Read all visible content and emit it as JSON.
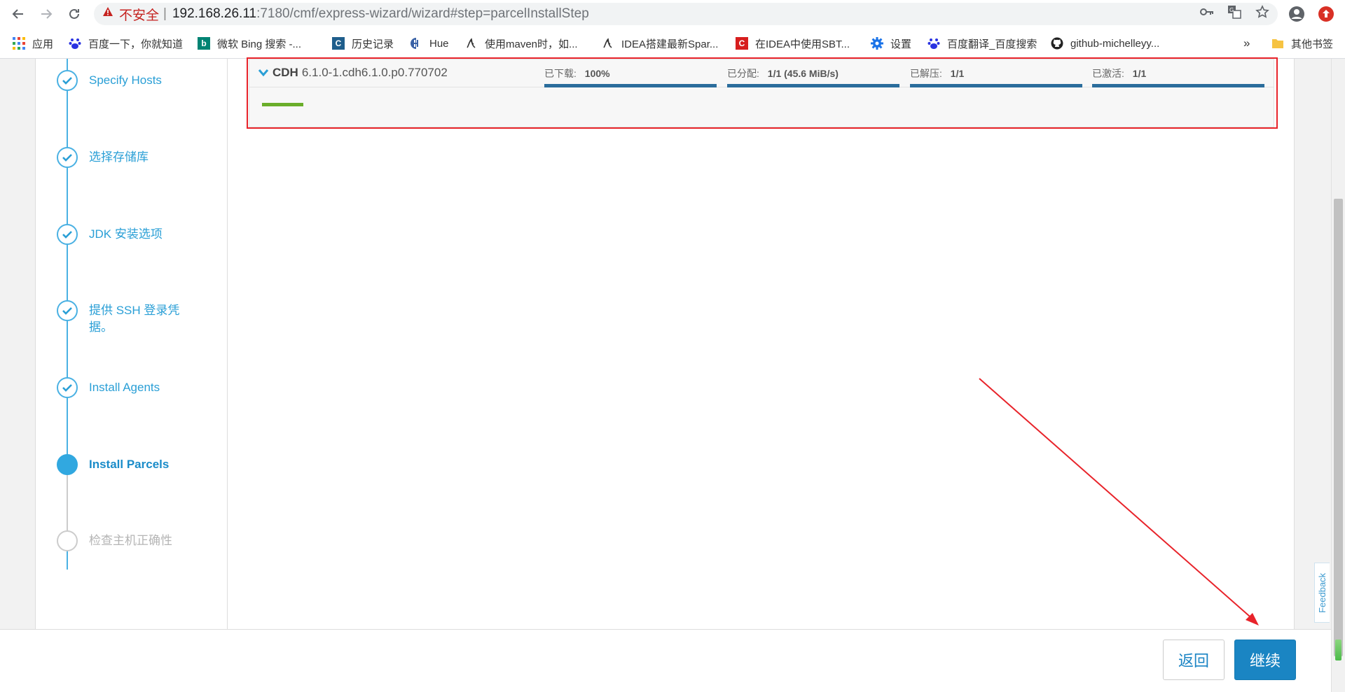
{
  "browser": {
    "security_warning": "不安全",
    "separator": "|",
    "url_host": "192.168.26.11",
    "url_path": ":7180/cmf/express-wizard/wizard#step=parcelInstallStep",
    "bookmarks": [
      {
        "label": "应用",
        "icon": "apps-grid-icon"
      },
      {
        "label": "百度一下，你就知道",
        "icon": "baidu-paw-icon"
      },
      {
        "label": "微软 Bing 搜索 -...",
        "icon": "bing-icon"
      },
      {
        "label": "历史记录",
        "icon": "history-c-icon"
      },
      {
        "label": "Hue",
        "icon": "hue-icon"
      },
      {
        "label": "使用maven时，如...",
        "icon": "script-icon"
      },
      {
        "label": "IDEA搭建最新Spar...",
        "icon": "script-icon"
      },
      {
        "label": "在IDEA中使用SBT...",
        "icon": "csdn-icon"
      },
      {
        "label": "设置",
        "icon": "gear-icon"
      },
      {
        "label": "百度翻译_百度搜索",
        "icon": "baidu-paw-icon"
      },
      {
        "label": "github-michelleyy...",
        "icon": "github-icon"
      }
    ],
    "overflow": "»",
    "other_bookmarks": "其他书签"
  },
  "wizard": {
    "steps": [
      {
        "label": "Specify Hosts",
        "state": "done"
      },
      {
        "label": "选择存储库",
        "state": "done"
      },
      {
        "label": "JDK 安装选项",
        "state": "done"
      },
      {
        "label": "提供 SSH 登录凭据。",
        "state": "done"
      },
      {
        "label": "Install Agents",
        "state": "done"
      },
      {
        "label": "Install Parcels",
        "state": "active"
      },
      {
        "label": "检查主机正确性",
        "state": "pending"
      }
    ]
  },
  "parcel": {
    "name": "CDH",
    "version": "6.1.0-1.cdh6.1.0.p0.770702",
    "stages": [
      {
        "label": "已下载:",
        "value": "100%",
        "progress": 1.0
      },
      {
        "label": "已分配:",
        "value": "1/1 (45.6 MiB/s)",
        "progress": 1.0
      },
      {
        "label": "已解压:",
        "value": "1/1",
        "progress": 1.0
      },
      {
        "label": "已激活:",
        "value": "1/1",
        "progress": 1.0
      }
    ],
    "overall_progress": 0.04
  },
  "footer": {
    "back_label": "返回",
    "next_label": "继续"
  },
  "feedback_label": "Feedback",
  "colors": {
    "accent": "#31a8e0",
    "annotation_red": "#e8232a",
    "primary_button": "#1a85c3",
    "progress_bar": "#2b6d9c",
    "progress_green": "#6aae2a"
  }
}
